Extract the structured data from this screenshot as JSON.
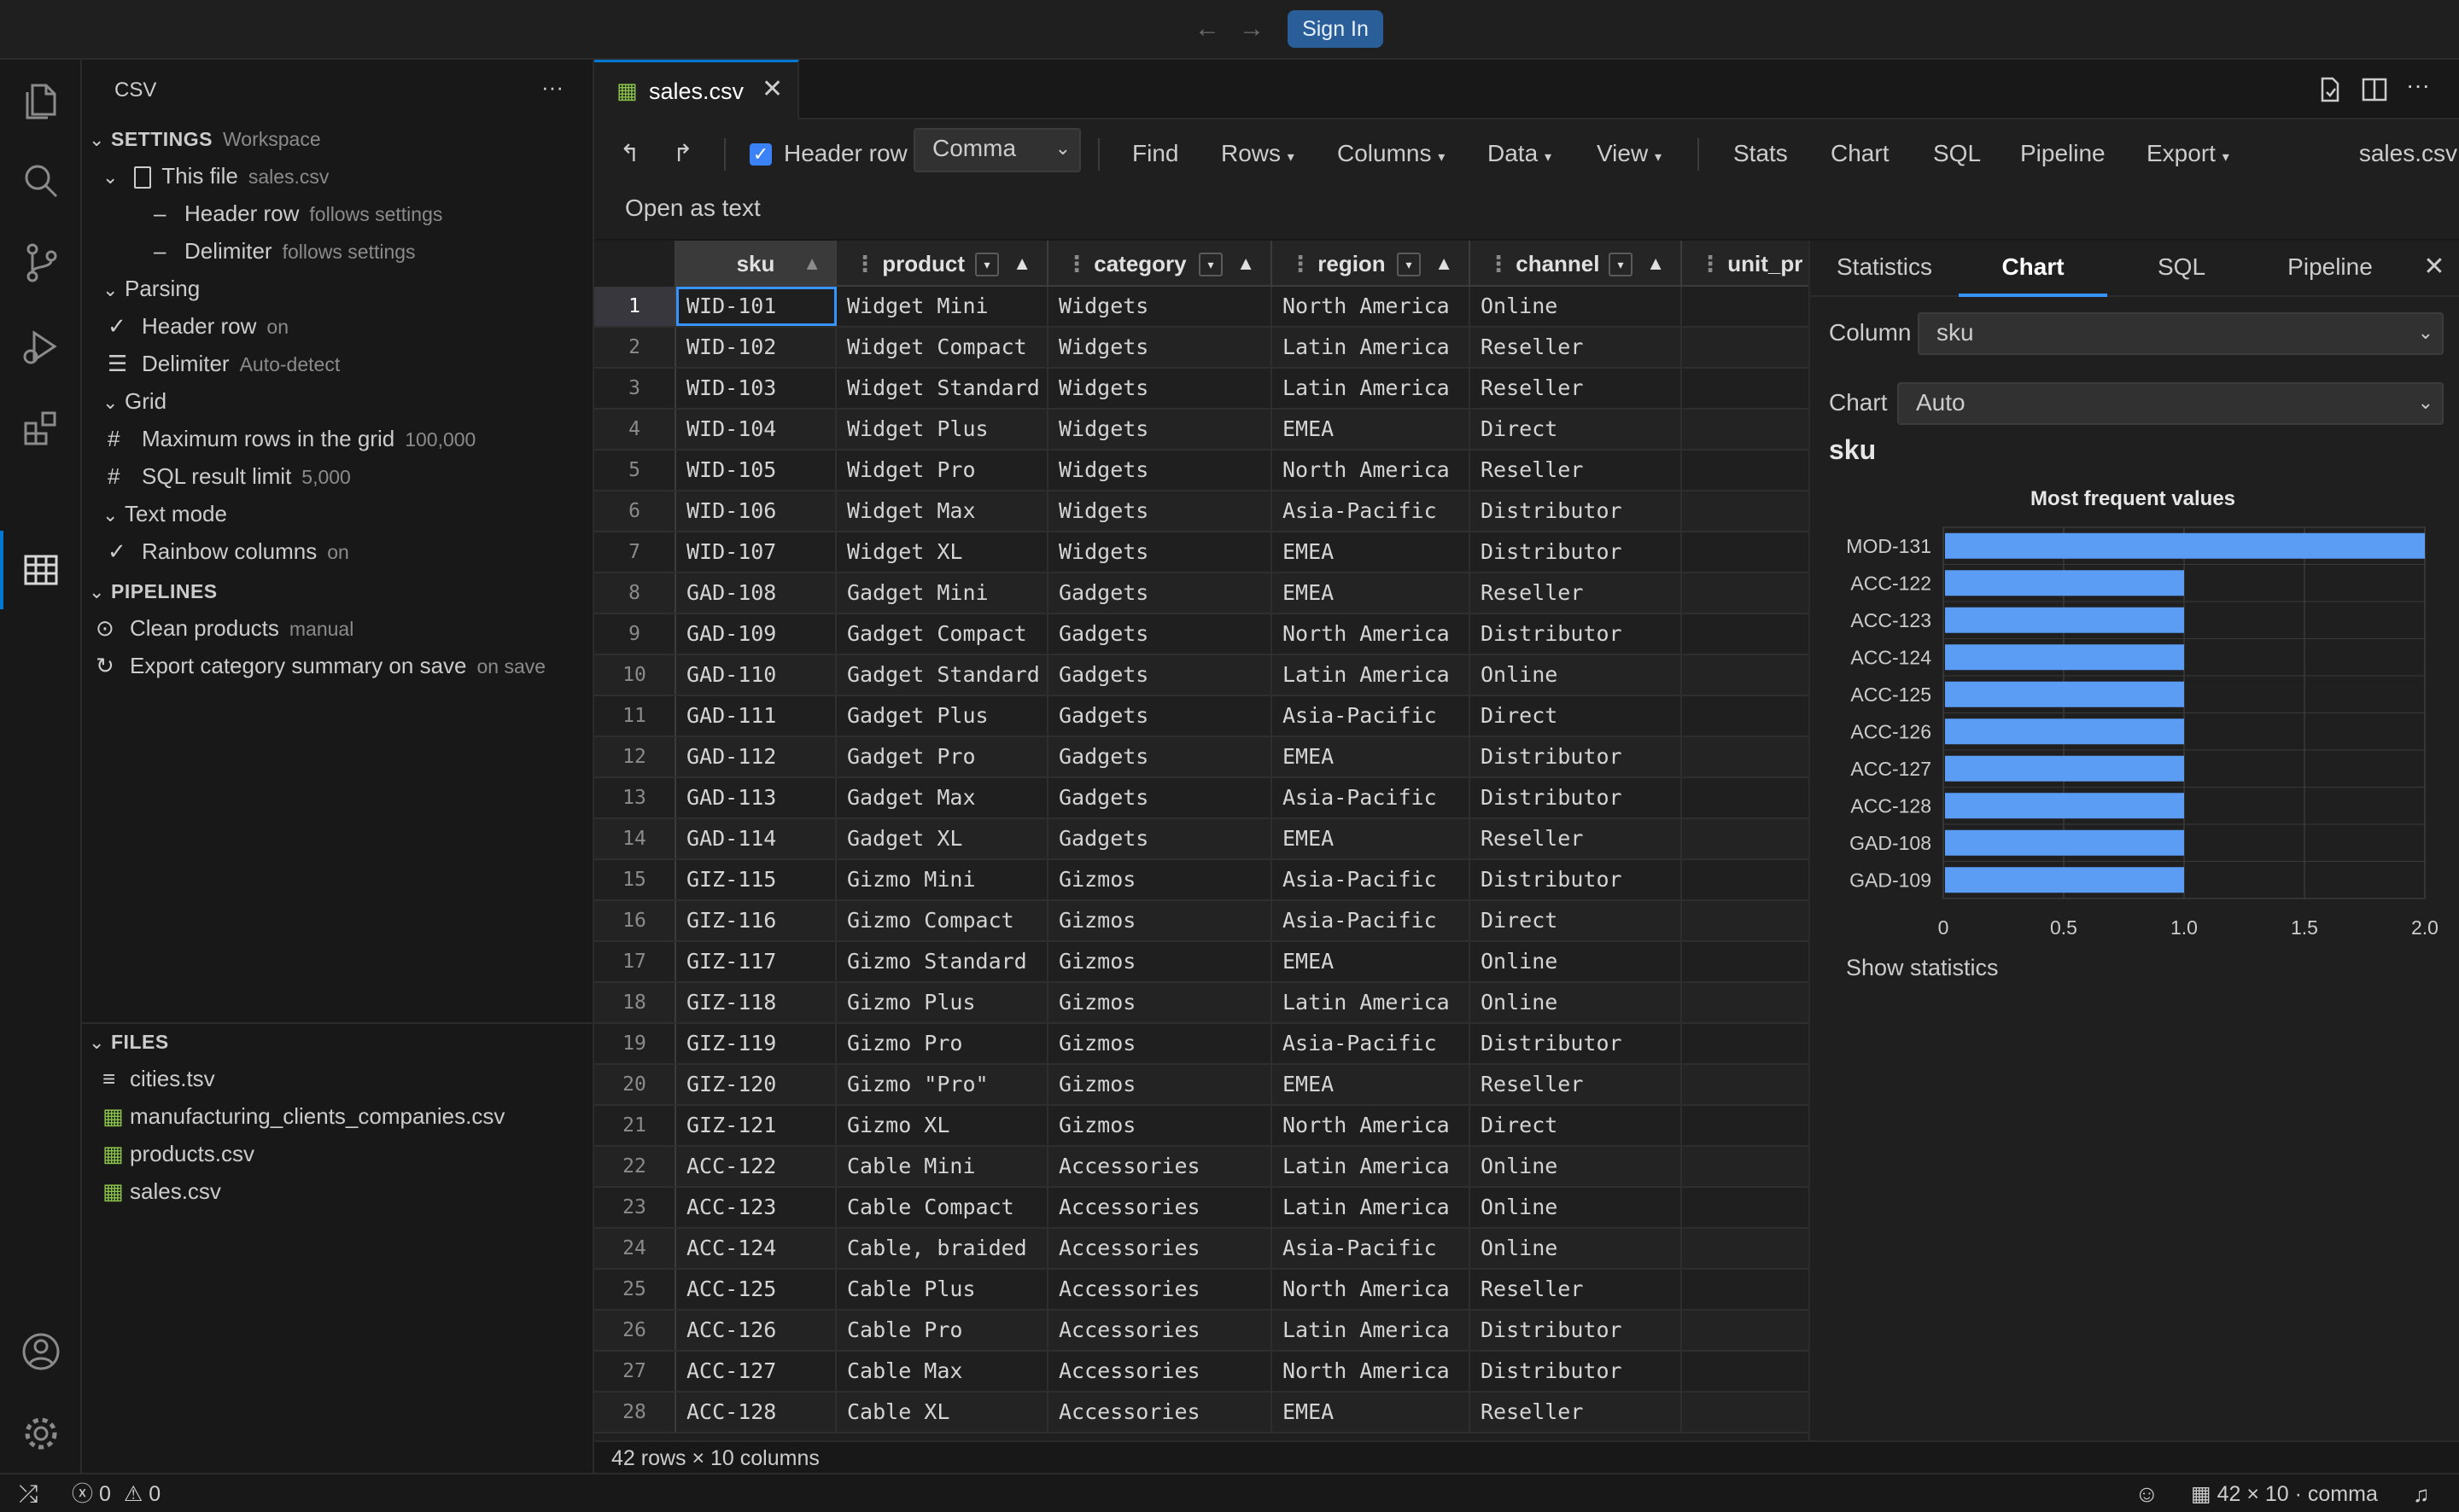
{
  "titlebar": {
    "sign_in": "Sign In",
    "back_icon": "arrow-left-icon",
    "forward_icon": "arrow-right-icon"
  },
  "sidebar": {
    "title": "CSV",
    "more": "···",
    "settings": {
      "header": "SETTINGS",
      "scope": "Workspace",
      "this_file": {
        "label": "This file",
        "desc": "sales.csv"
      },
      "header_row": {
        "label": "Header row",
        "desc": "follows settings"
      },
      "delimiter": {
        "label": "Delimiter",
        "desc": "follows settings"
      },
      "parsing": "Parsing",
      "parsing_header_row": {
        "label": "Header row",
        "desc": "on"
      },
      "parsing_delimiter": {
        "label": "Delimiter",
        "desc": "Auto-detect"
      },
      "grid": "Grid",
      "max_rows": {
        "label": "Maximum rows in the grid",
        "desc": "100,000"
      },
      "sql_limit": {
        "label": "SQL result limit",
        "desc": "5,000"
      },
      "text_mode": "Text mode",
      "rainbow": {
        "label": "Rainbow columns",
        "desc": "on"
      }
    },
    "pipelines": {
      "header": "PIPELINES",
      "items": [
        {
          "label": "Clean products",
          "desc": "manual"
        },
        {
          "label": "Export category summary on save",
          "desc": "on save"
        }
      ]
    },
    "files": {
      "header": "FILES",
      "items": [
        "cities.tsv",
        "manufacturing_clients_companies.csv",
        "products.csv",
        "sales.csv"
      ]
    }
  },
  "editor": {
    "tab_label": "sales.csv",
    "toolbar": {
      "header_row": "Header row",
      "delimiter": "Comma",
      "find": "Find",
      "rows": "Rows",
      "columns": "Columns",
      "data": "Data",
      "view": "View",
      "stats": "Stats",
      "chart": "Chart",
      "sql": "SQL",
      "pipeline": "Pipeline",
      "export": "Export",
      "filename": "sales.csv",
      "open_as_text": "Open as text"
    },
    "grid": {
      "columns": [
        "sku",
        "product",
        "category",
        "region",
        "channel",
        "unit_pr"
      ],
      "rows": [
        [
          "1",
          "WID-101",
          "Widget Mini",
          "Widgets",
          "North America",
          "Online"
        ],
        [
          "2",
          "WID-102",
          "Widget Compact",
          "Widgets",
          "Latin America",
          "Reseller"
        ],
        [
          "3",
          "WID-103",
          "Widget Standard",
          "Widgets",
          "Latin America",
          "Reseller"
        ],
        [
          "4",
          "WID-104",
          "Widget Plus",
          "Widgets",
          "EMEA",
          "Direct"
        ],
        [
          "5",
          "WID-105",
          "Widget Pro",
          "Widgets",
          "North America",
          "Reseller"
        ],
        [
          "6",
          "WID-106",
          "Widget Max",
          "Widgets",
          "Asia-Pacific",
          "Distributor"
        ],
        [
          "7",
          "WID-107",
          "Widget XL",
          "Widgets",
          "EMEA",
          "Distributor"
        ],
        [
          "8",
          "GAD-108",
          "Gadget Mini",
          "Gadgets",
          "EMEA",
          "Reseller"
        ],
        [
          "9",
          "GAD-109",
          "Gadget Compact",
          "Gadgets",
          "North America",
          "Distributor"
        ],
        [
          "10",
          "GAD-110",
          "Gadget Standard",
          "Gadgets",
          "Latin America",
          "Online"
        ],
        [
          "11",
          "GAD-111",
          "Gadget Plus",
          "Gadgets",
          "Asia-Pacific",
          "Direct"
        ],
        [
          "12",
          "GAD-112",
          "Gadget Pro",
          "Gadgets",
          "EMEA",
          "Distributor"
        ],
        [
          "13",
          "GAD-113",
          "Gadget Max",
          "Gadgets",
          "Asia-Pacific",
          "Distributor"
        ],
        [
          "14",
          "GAD-114",
          "Gadget XL",
          "Gadgets",
          "EMEA",
          "Reseller"
        ],
        [
          "15",
          "GIZ-115",
          "Gizmo Mini",
          "Gizmos",
          "Asia-Pacific",
          "Distributor"
        ],
        [
          "16",
          "GIZ-116",
          "Gizmo Compact",
          "Gizmos",
          "Asia-Pacific",
          "Direct"
        ],
        [
          "17",
          "GIZ-117",
          "Gizmo Standard",
          "Gizmos",
          "EMEA",
          "Online"
        ],
        [
          "18",
          "GIZ-118",
          "Gizmo Plus",
          "Gizmos",
          "Latin America",
          "Online"
        ],
        [
          "19",
          "GIZ-119",
          "Gizmo Pro",
          "Gizmos",
          "Asia-Pacific",
          "Distributor"
        ],
        [
          "20",
          "GIZ-120",
          "Gizmo \"Pro\"",
          "Gizmos",
          "EMEA",
          "Reseller"
        ],
        [
          "21",
          "GIZ-121",
          "Gizmo XL",
          "Gizmos",
          "North America",
          "Direct"
        ],
        [
          "22",
          "ACC-122",
          "Cable Mini",
          "Accessories",
          "Latin America",
          "Online"
        ],
        [
          "23",
          "ACC-123",
          "Cable Compact",
          "Accessories",
          "Latin America",
          "Online"
        ],
        [
          "24",
          "ACC-124",
          "Cable, braided",
          "Accessories",
          "Asia-Pacific",
          "Online"
        ],
        [
          "25",
          "ACC-125",
          "Cable Plus",
          "Accessories",
          "North America",
          "Reseller"
        ],
        [
          "26",
          "ACC-126",
          "Cable Pro",
          "Accessories",
          "Latin America",
          "Distributor"
        ],
        [
          "27",
          "ACC-127",
          "Cable Max",
          "Accessories",
          "North America",
          "Distributor"
        ],
        [
          "28",
          "ACC-128",
          "Cable XL",
          "Accessories",
          "EMEA",
          "Reseller"
        ]
      ],
      "footer": "42 rows × 10 columns"
    }
  },
  "panel": {
    "tabs": [
      "Statistics",
      "Chart",
      "SQL",
      "Pipeline"
    ],
    "active_tab": "Chart",
    "column_label": "Column",
    "column_value": "sku",
    "chart_label": "Chart",
    "chart_value": "Auto",
    "section_title": "sku",
    "show_statistics": "Show statistics"
  },
  "chart_data": {
    "type": "bar",
    "orientation": "horizontal",
    "title": "Most frequent values",
    "categories": [
      "MOD-131",
      "ACC-122",
      "ACC-123",
      "ACC-124",
      "ACC-125",
      "ACC-126",
      "ACC-127",
      "ACC-128",
      "GAD-108",
      "GAD-109"
    ],
    "values": [
      2,
      1,
      1,
      1,
      1,
      1,
      1,
      1,
      1,
      1
    ],
    "xlim": [
      0,
      2
    ],
    "xticks": [
      "0",
      "0.5",
      "1.0",
      "1.5",
      "2.0"
    ],
    "grid": true,
    "bar_color": "#5b9cf5"
  },
  "statusbar": {
    "errors": "0",
    "warnings": "0",
    "grid_info": "42 × 10 · comma"
  },
  "colors": {
    "accent": "#0078d4",
    "signin": "#2a5e99",
    "csv_icon": "#8bc34a"
  }
}
